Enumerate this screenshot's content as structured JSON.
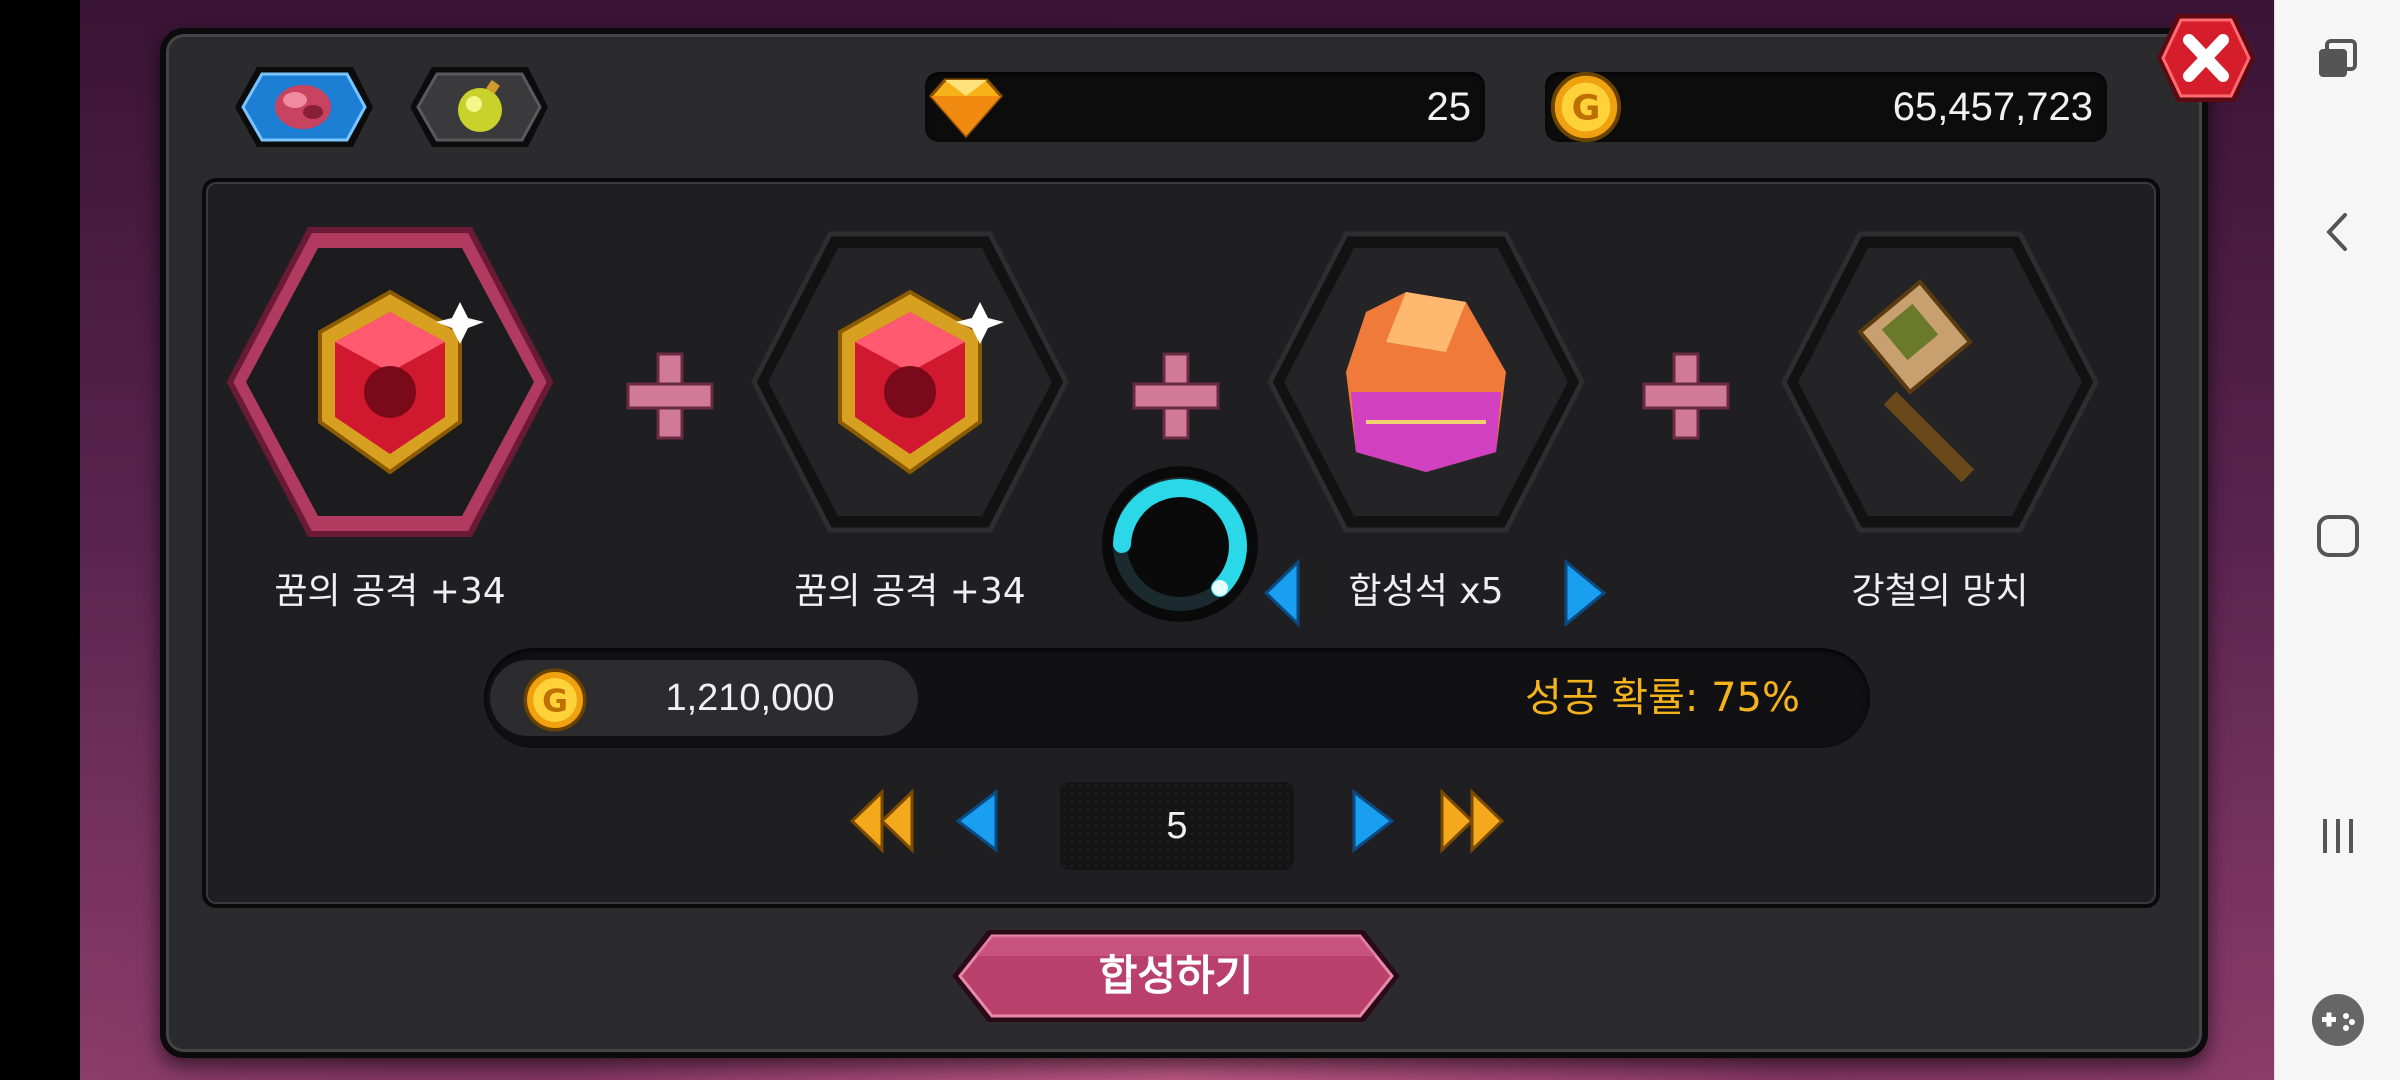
{
  "currency": {
    "diamonds": "25",
    "gold": "65,457,723"
  },
  "synthesis": {
    "slots": [
      {
        "label": "꿈의 공격 +34",
        "icon": "ruby-gem-icon",
        "selected": true
      },
      {
        "label": "꿈의 공격 +34",
        "icon": "ruby-gem-icon",
        "selected": false
      },
      {
        "label": "합성석 x5",
        "icon": "synthesis-stone-icon",
        "selected": false
      },
      {
        "label": "강철의 망치",
        "icon": "steel-hammer-icon",
        "selected": false
      }
    ],
    "cost": "1,210,000",
    "success_rate": "성공 확률: 75%",
    "page": "5",
    "button_label": "합성하기"
  },
  "colors": {
    "accent_pink": "#b8406a",
    "gold_text": "#f4b21c",
    "arrow_blue": "#1a9ff0",
    "arrow_gold": "#f4a81c"
  }
}
